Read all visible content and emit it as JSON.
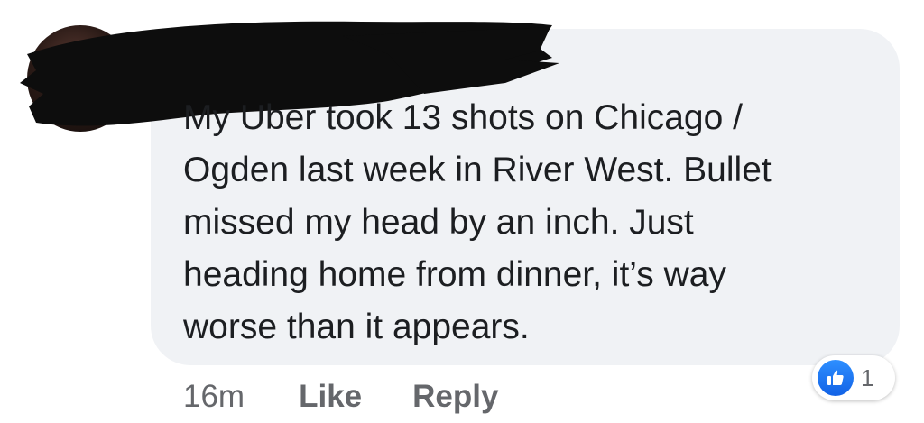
{
  "comment": {
    "author": "",
    "lines": [
      "My Uber took 13 shots on Chicago /",
      "Ogden last week in River West. Bullet",
      "missed my head by an inch. Just",
      "heading home from dinner, it’s way",
      "worse than it appears."
    ],
    "timestamp": "16m",
    "like_label": "Like",
    "reply_label": "Reply",
    "reaction": {
      "icon": "like-icon",
      "count": "1"
    }
  },
  "colors": {
    "bubble": "#f0f2f5",
    "text": "#1c1e21",
    "meta": "#65676b",
    "like_blue": "#1877f2",
    "redaction": "#0d0d0d"
  }
}
